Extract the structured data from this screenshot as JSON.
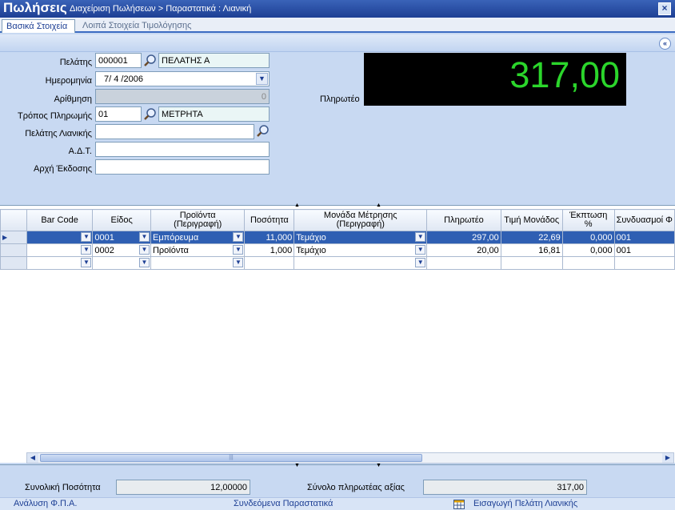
{
  "title": {
    "app": "Πωλήσεις",
    "breadcrumb": "Διαχείριση Πωλήσεων > Παραστατικά : Λιανική",
    "close": "×"
  },
  "tabs": [
    {
      "label": "Βασικά Στοιχεία"
    },
    {
      "label": "Λοιπά Στοιχεία Τιμολόγησης"
    }
  ],
  "collapse_icon": "«",
  "form": {
    "customer": {
      "label": "Πελάτης",
      "code": "000001",
      "name": "ΠΕΛΑΤΗΣ Α"
    },
    "date": {
      "label": "Ημερομηνία",
      "value": "7/ 4 /2006"
    },
    "number": {
      "label": "Αρίθμηση",
      "value": "0"
    },
    "payment": {
      "label": "Τρόπος Πληρωμής",
      "code": "01",
      "name": "ΜΕΤΡΗΤΑ"
    },
    "retail_customer": {
      "label": "Πελάτης Λιανικής",
      "value": ""
    },
    "id_number": {
      "label": "Α.Δ.Τ.",
      "value": ""
    },
    "issuing_authority": {
      "label": "Αρχή Έκδοσης",
      "value": ""
    }
  },
  "payable": {
    "label": "Πληρωτέο",
    "value": "317,00",
    "color": "#2bd62b"
  },
  "grid": {
    "columns": [
      "",
      "Bar Code",
      "Είδος",
      "Προϊόντα\n(Περιγραφή)",
      "Ποσότητα",
      "Μονάδα Μέτρησης\n(Περιγραφή)",
      "Πληρωτέο",
      "Τιμή Μονάδος",
      "Έκπτωση\n%",
      "Συνδυασμοί Φ"
    ],
    "rows": [
      {
        "barcode": "",
        "item": "0001",
        "product": "Εμπόρευμα",
        "qty": "11,000",
        "unit": "Τεμάχιο",
        "payable": "297,00",
        "unit_price": "22,69",
        "discount": "0,000",
        "combo": "001"
      },
      {
        "barcode": "",
        "item": "0002",
        "product": "Προϊόντα",
        "qty": "1,000",
        "unit": "Τεμάχιο",
        "payable": "20,00",
        "unit_price": "16,81",
        "discount": "0,000",
        "combo": "001"
      },
      {
        "barcode": "",
        "item": "",
        "product": "",
        "qty": "",
        "unit": "",
        "payable": "",
        "unit_price": "",
        "discount": "",
        "combo": ""
      }
    ]
  },
  "scroll_grip": "|||",
  "totals": {
    "quantity_label": "Συνολική Ποσότητα",
    "quantity_value": "12,00000",
    "payable_label": "Σύνολο πληρωτέας αξίας",
    "payable_value": "317,00"
  },
  "links": {
    "vat": "Ανάλυση Φ.Π.Α.",
    "related": "Συνδεόμενα Παραστατικά",
    "add_retail": "Εισαγωγή Πελάτη Λιανικής"
  }
}
